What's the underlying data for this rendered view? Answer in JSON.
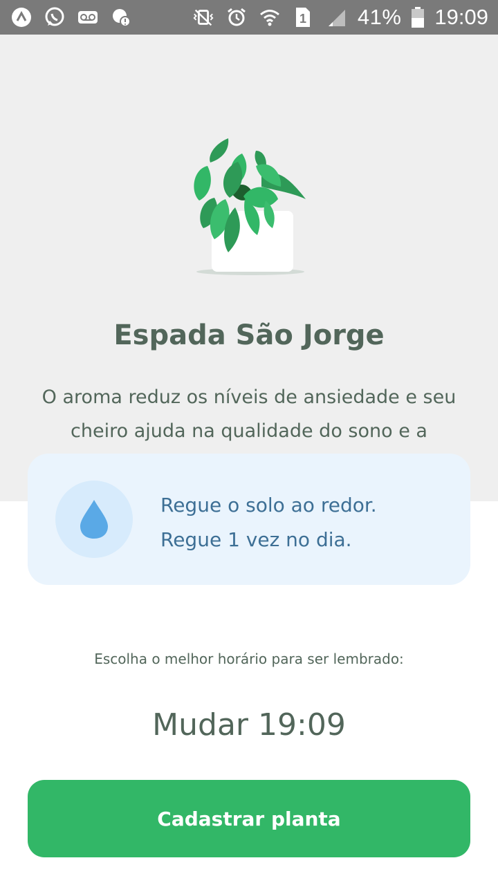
{
  "status_bar": {
    "battery": "41%",
    "time": "19:09",
    "sim_slot": "1",
    "icons_left": [
      "app-a-icon",
      "whatsapp-icon",
      "voicemail-icon",
      "chat-alert-icon"
    ],
    "icons_right": [
      "vibrate-icon",
      "alarm-icon",
      "wifi-icon",
      "sim-icon",
      "signal-icon",
      "battery-icon"
    ]
  },
  "plant": {
    "name": "Espada São Jorge",
    "description": "O aroma reduz os níveis de ansiedade e seu cheiro ajuda na qualidade do sono e a produtividade durante o dia.",
    "illustration": "potted-plant-illustration"
  },
  "water_tips": {
    "icon": "water-drop-icon",
    "line1": "Regue o solo ao redor.",
    "line2": "Regue 1 vez no dia."
  },
  "reminder": {
    "label": "Escolha o melhor horário para ser lembrado:",
    "change_label": "Mudar",
    "time": "19:09"
  },
  "actions": {
    "register_label": "Cadastrar planta"
  },
  "colors": {
    "status_bar": "#7a7a7a",
    "top_background": "#efefef",
    "heading_text": "#52665a",
    "card_background": "#eaf4fd",
    "card_icon_background": "#d7ebfc",
    "card_text": "#3d6f95",
    "drop": "#5aa9e6",
    "button": "#32b767"
  }
}
